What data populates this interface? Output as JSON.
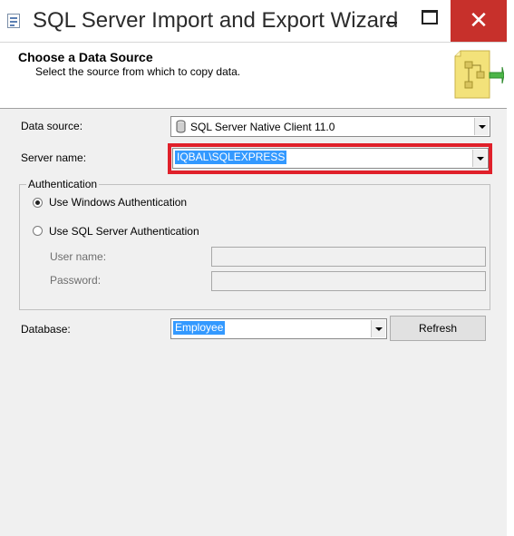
{
  "window": {
    "title": "SQL Server Import and Export Wizard",
    "close_glyph": "✕",
    "app_icon": "wizard-app-icon"
  },
  "header": {
    "title": "Choose a Data Source",
    "subtitle": "Select the source from which to copy data."
  },
  "form": {
    "data_source": {
      "label": "Data source:",
      "value": "SQL Server Native Client 11.0",
      "icon": "database-cylinder-icon"
    },
    "server_name": {
      "label": "Server name:",
      "value": "IQBAL\\SQLEXPRESS"
    },
    "authentication": {
      "legend": "Authentication",
      "windows_option": "Use Windows Authentication",
      "sql_option": "Use SQL Server Authentication",
      "selected": "windows",
      "user_name_label": "User name:",
      "password_label": "Password:",
      "user_name_value": "",
      "password_value": ""
    },
    "database": {
      "label": "Database:",
      "value": "Employee"
    },
    "refresh_label": "Refresh"
  },
  "colors": {
    "highlight_border": "#e0202a",
    "selection": "#3399ff",
    "close_button": "#c7302b"
  }
}
